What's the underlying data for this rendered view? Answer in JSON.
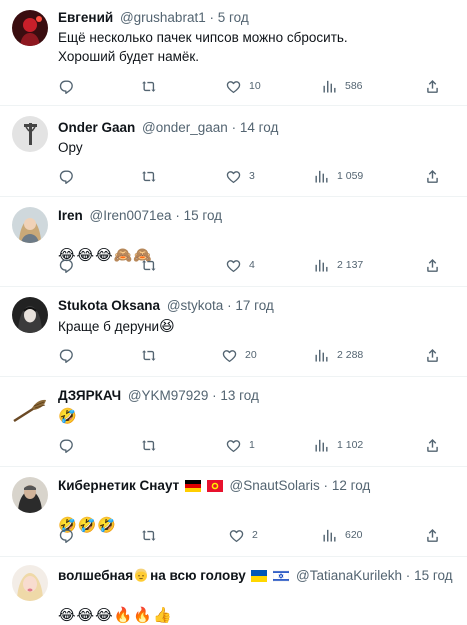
{
  "tweets": [
    {
      "name": "Евгений",
      "handle": "@grushabrat1",
      "sep": "·",
      "time": "5 год",
      "text": "Ещё  несколько пачек чипсов можно сбросить.\nХороший будет намёк.",
      "replies": "",
      "retweets": "",
      "likes": "10",
      "views": "586"
    },
    {
      "name": "Onder Gaan",
      "handle": "@onder_gaan",
      "sep": "·",
      "time": "14 год",
      "text": "Ору",
      "replies": "",
      "retweets": "",
      "likes": "3",
      "views": "1 059"
    },
    {
      "name": "Iren",
      "handle": "@Iren0071ea",
      "sep": "·",
      "time": "15 год",
      "emojis": [
        "😂",
        "😂",
        "😂",
        "🙈",
        "🙈"
      ],
      "replies": "",
      "retweets": "",
      "likes": "4",
      "views": "2 137"
    },
    {
      "name": "Stukota Oksana",
      "handle": "@stykota",
      "sep": "·",
      "time": "17 год",
      "text": "Краще б деруни",
      "emojis": [
        "😆"
      ],
      "replies": "",
      "retweets": "",
      "likes": "20",
      "views": "2 288"
    },
    {
      "name": "ДЗЯРКАЧ",
      "handle": "@YKM97929",
      "sep": "·",
      "time": "13 год",
      "emojis": [
        "🤣"
      ],
      "replies": "",
      "retweets": "",
      "likes": "1",
      "views": "1 102"
    },
    {
      "name": "Кибернетик Снаут",
      "handle": "@SnautSolaris",
      "sep": "·",
      "time": "12 год",
      "emojis": [
        "🤣",
        "🤣",
        "🤣"
      ],
      "replies": "",
      "retweets": "",
      "likes": "2",
      "views": "620"
    },
    {
      "name_a": "волшебная",
      "name_b": "на всю голову",
      "handle": "@TatianaKurilekh",
      "sep": "·",
      "time": "15 год",
      "emojis": [
        "😂",
        "😂",
        "😂",
        "🔥",
        "🔥",
        "👍"
      ]
    }
  ],
  "icons": {
    "reply": "reply-icon",
    "retweet": "retweet-icon",
    "like": "heart-icon",
    "views": "views-icon",
    "share": "share-icon"
  },
  "colors": {
    "text": "#0f1419",
    "secondary": "#536471",
    "divider": "#eff3f4",
    "emoji_yellow": "#ffcc33"
  }
}
